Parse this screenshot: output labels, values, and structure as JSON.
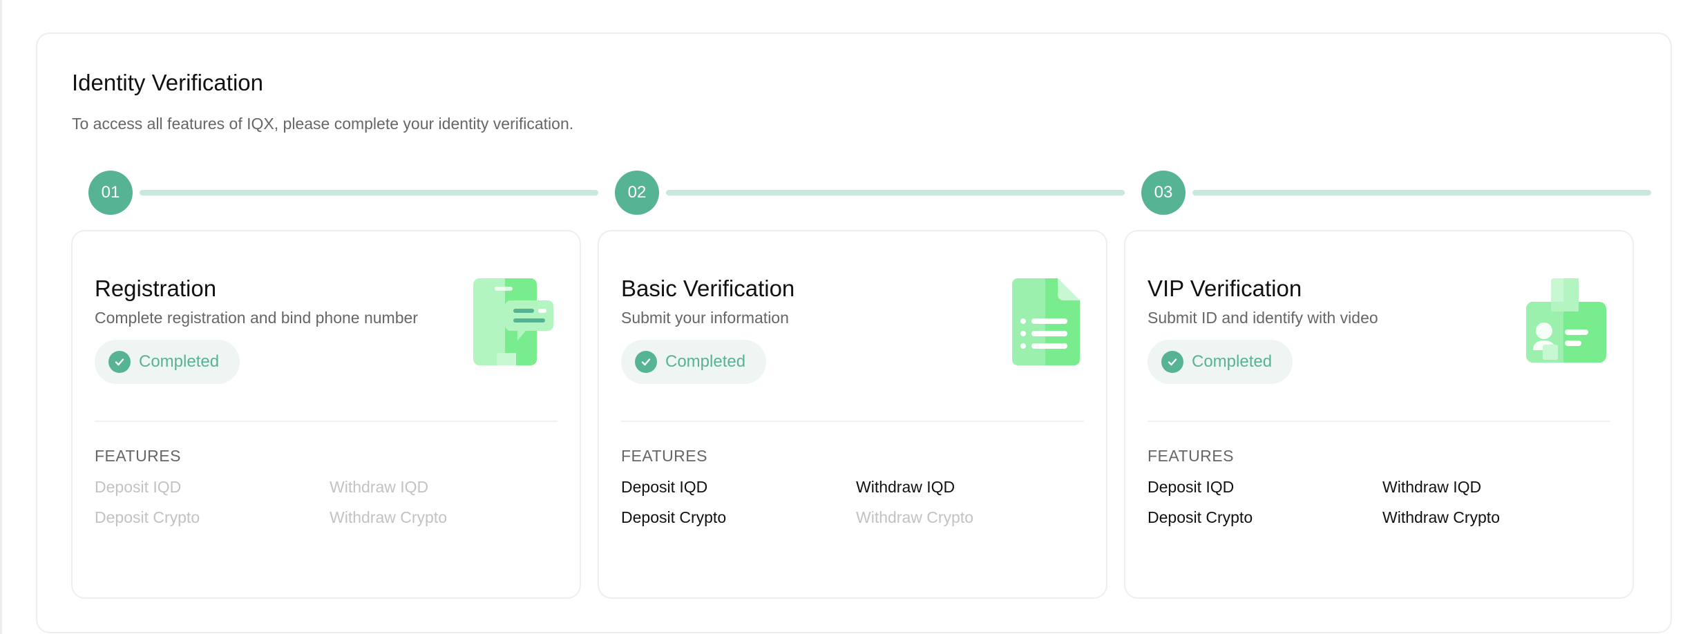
{
  "header": {
    "title": "Identity Verification",
    "subtitle": "To access all features of IQX, please complete your identity verification."
  },
  "steps": [
    {
      "number": "01",
      "title": "Registration",
      "description": "Complete registration and bind phone number",
      "status": "Completed",
      "features_label": "FEATURES",
      "features": [
        {
          "label": "Deposit IQD",
          "enabled": false
        },
        {
          "label": "Withdraw IQD",
          "enabled": false
        },
        {
          "label": "Deposit Crypto",
          "enabled": false
        },
        {
          "label": "Withdraw Crypto",
          "enabled": false
        }
      ],
      "icon": "phone-chat-icon"
    },
    {
      "number": "02",
      "title": "Basic Verification",
      "description": "Submit your information",
      "status": "Completed",
      "features_label": "FEATURES",
      "features": [
        {
          "label": "Deposit IQD",
          "enabled": true
        },
        {
          "label": "Withdraw IQD",
          "enabled": true
        },
        {
          "label": "Deposit Crypto",
          "enabled": true
        },
        {
          "label": "Withdraw Crypto",
          "enabled": false
        }
      ],
      "icon": "document-list-icon"
    },
    {
      "number": "03",
      "title": "VIP Verification",
      "description": "Submit ID and identify with video",
      "status": "Completed",
      "features_label": "FEATURES",
      "features": [
        {
          "label": "Deposit IQD",
          "enabled": true
        },
        {
          "label": "Withdraw IQD",
          "enabled": true
        },
        {
          "label": "Deposit Crypto",
          "enabled": true
        },
        {
          "label": "Withdraw Crypto",
          "enabled": true
        }
      ],
      "icon": "id-badge-icon"
    }
  ],
  "colors": {
    "accent": "#56b394",
    "accent_light": "#c9e7dc",
    "badge_bg": "#eff5f3",
    "illustration_green": "#79ec8e",
    "illustration_light": "#b3f5c1",
    "feature_enabled": "#111111",
    "feature_disabled": "#c2c2c2"
  }
}
